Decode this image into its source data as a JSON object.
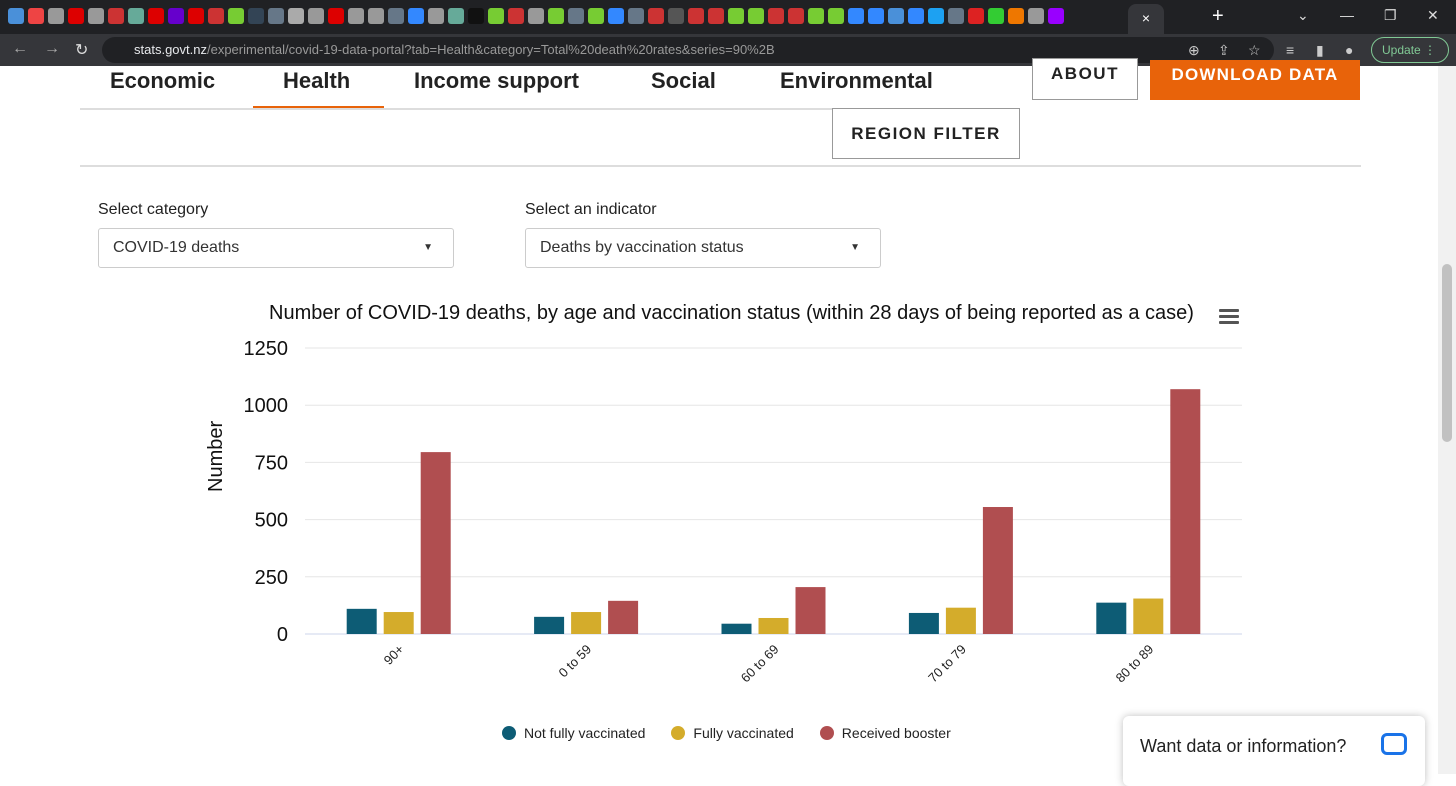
{
  "browser": {
    "url_domain": "stats.govt.nz",
    "url_path": "/experimental/covid-19-data-portal?tab=Health&category=Total%20death%20rates&series=90%2B",
    "update_label": "Update",
    "close_tab": "×",
    "new_tab": "+"
  },
  "nav": {
    "tabs": [
      "Economic",
      "Health",
      "Income support",
      "Social",
      "Environmental"
    ],
    "active_tab": "Health",
    "about": "ABOUT",
    "download": "DOWNLOAD DATA",
    "region_filter": "REGION FILTER"
  },
  "filters": {
    "category_label": "Select category",
    "category_value": "COVID-19 deaths",
    "indicator_label": "Select an indicator",
    "indicator_value": "Deaths by vaccination status"
  },
  "chart_data": {
    "type": "bar",
    "title": "Number of COVID-19 deaths, by age and vaccination status (within 28 days of being reported as a case)",
    "xlabel": "",
    "ylabel": "Number",
    "ylim": [
      0,
      1250
    ],
    "yticks": [
      "0",
      "250",
      "500",
      "750",
      "1000",
      "1250"
    ],
    "categories": [
      "90+",
      "0 to 59",
      "60 to 69",
      "70 to 79",
      "80 to 89"
    ],
    "grid": true,
    "legend": "bottom",
    "series": [
      {
        "name": "Not fully vaccinated",
        "color": "#0d5c75",
        "values": [
          110,
          75,
          45,
          92,
          137
        ]
      },
      {
        "name": "Fully vaccinated",
        "color": "#d4ac2b",
        "values": [
          96,
          96,
          70,
          115,
          155
        ]
      },
      {
        "name": "Received booster",
        "color": "#b04e50",
        "values": [
          795,
          145,
          205,
          555,
          1070
        ]
      }
    ]
  },
  "chat": {
    "label": "Want data or information?"
  }
}
